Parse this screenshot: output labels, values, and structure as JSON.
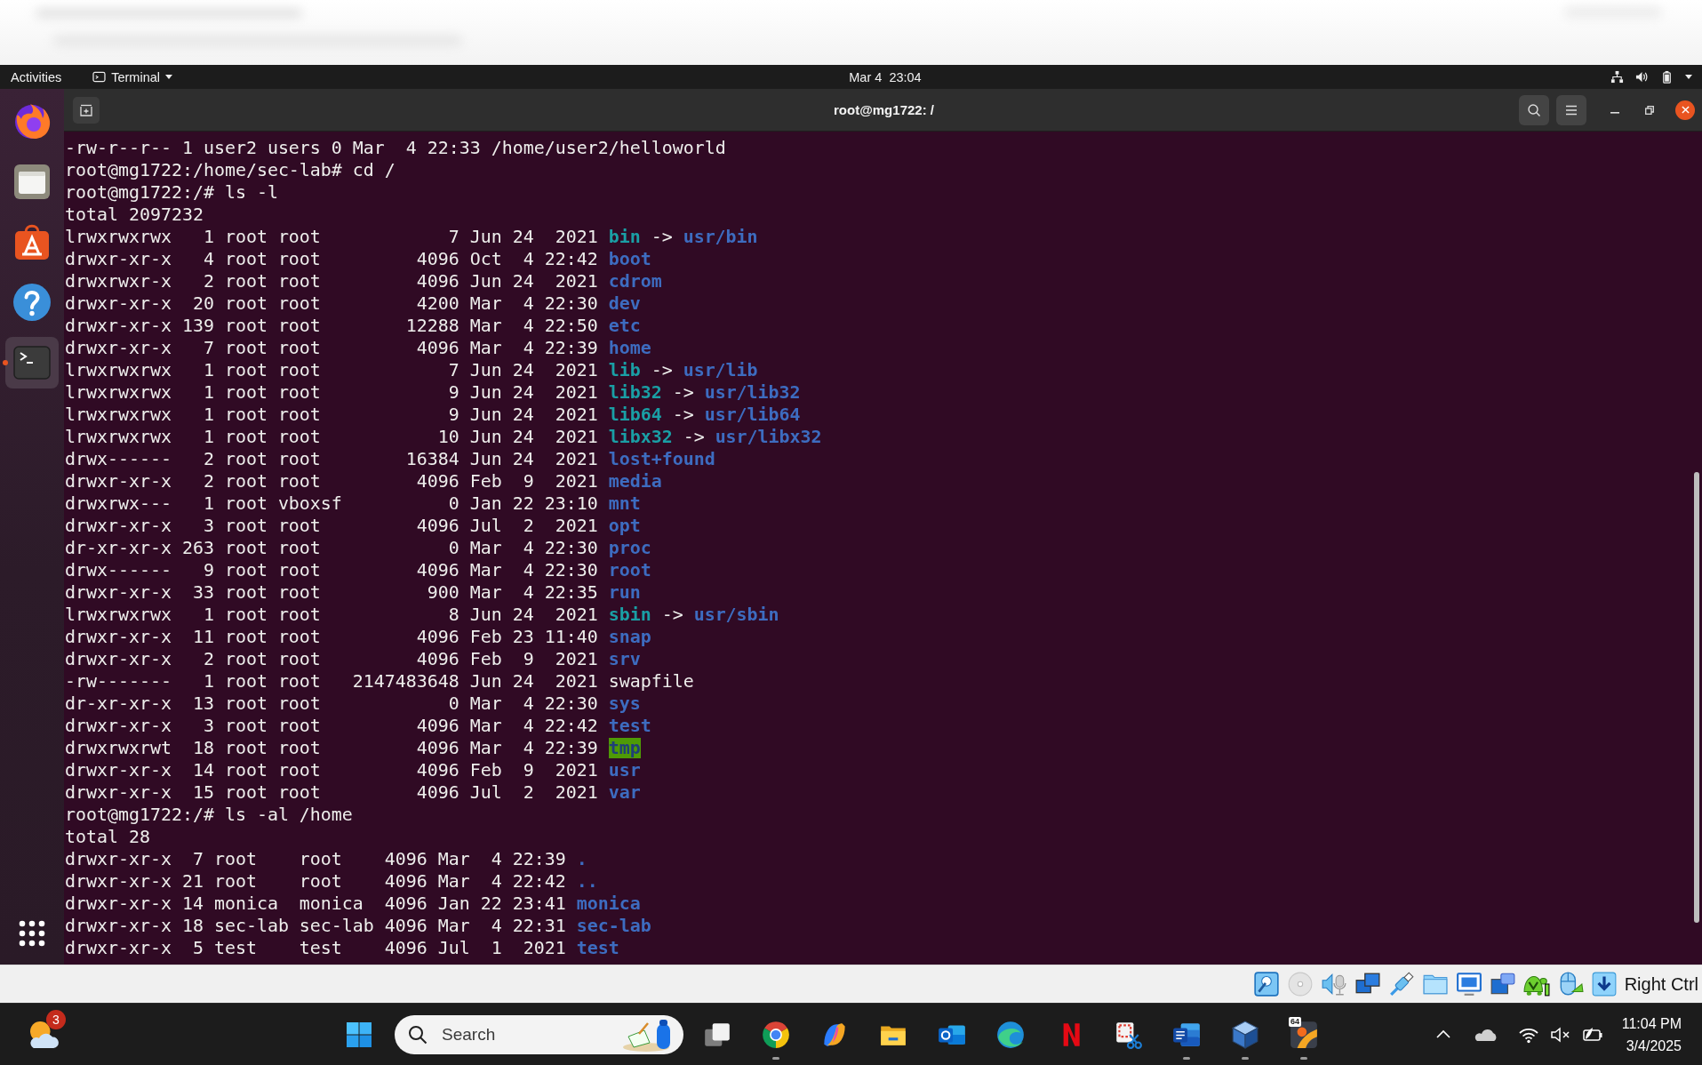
{
  "top_bar": {
    "activities": "Activities",
    "app_menu": "Terminal",
    "clock": "Mar 4  23:04"
  },
  "dock": {
    "items": [
      {
        "kind": "browser",
        "selected": false,
        "running": false
      },
      {
        "kind": "files",
        "selected": false,
        "running": false
      },
      {
        "kind": "store",
        "selected": false,
        "running": false
      },
      {
        "kind": "help",
        "selected": false,
        "running": false
      },
      {
        "kind": "terminal",
        "selected": true,
        "running": true
      }
    ]
  },
  "terminal": {
    "title": "root@mg1722: /",
    "lines": [
      {
        "kind": "text",
        "text": "-rw-r--r-- 1 user2 users 0 Mar  4 22:33 /home/user2/helloworld"
      },
      {
        "kind": "text",
        "text": "root@mg1722:/home/sec-lab# cd /"
      },
      {
        "kind": "text",
        "text": "root@mg1722:/# ls -l"
      },
      {
        "kind": "text",
        "text": "total 2097232"
      },
      {
        "kind": "entry",
        "details": "lrwxrwxrwx   1 root root            7 Jun 24  2021",
        "file": {
          "kind": "link",
          "name": "bin"
        },
        "arrow": "->",
        "target": "usr/bin"
      },
      {
        "kind": "entry",
        "details": "drwxr-xr-x   4 root root         4096 Oct  4 22:42",
        "file": {
          "kind": "dir",
          "name": "boot"
        }
      },
      {
        "kind": "entry",
        "details": "drwxrwxr-x   2 root root         4096 Jun 24  2021",
        "file": {
          "kind": "dir",
          "name": "cdrom"
        }
      },
      {
        "kind": "entry",
        "details": "drwxr-xr-x  20 root root         4200 Mar  4 22:30",
        "file": {
          "kind": "dir",
          "name": "dev"
        }
      },
      {
        "kind": "entry",
        "details": "drwxr-xr-x 139 root root        12288 Mar  4 22:50",
        "file": {
          "kind": "dir",
          "name": "etc"
        }
      },
      {
        "kind": "entry",
        "details": "drwxr-xr-x   7 root root         4096 Mar  4 22:39",
        "file": {
          "kind": "dir",
          "name": "home"
        }
      },
      {
        "kind": "entry",
        "details": "lrwxrwxrwx   1 root root            7 Jun 24  2021",
        "file": {
          "kind": "link",
          "name": "lib"
        },
        "arrow": "->",
        "target": "usr/lib"
      },
      {
        "kind": "entry",
        "details": "lrwxrwxrwx   1 root root            9 Jun 24  2021",
        "file": {
          "kind": "link",
          "name": "lib32"
        },
        "arrow": "->",
        "target": "usr/lib32"
      },
      {
        "kind": "entry",
        "details": "lrwxrwxrwx   1 root root            9 Jun 24  2021",
        "file": {
          "kind": "link",
          "name": "lib64"
        },
        "arrow": "->",
        "target": "usr/lib64"
      },
      {
        "kind": "entry",
        "details": "lrwxrwxrwx   1 root root           10 Jun 24  2021",
        "file": {
          "kind": "link",
          "name": "libx32"
        },
        "arrow": "->",
        "target": "usr/libx32"
      },
      {
        "kind": "entry",
        "details": "drwx------   2 root root        16384 Jun 24  2021",
        "file": {
          "kind": "dir",
          "name": "lost+found"
        }
      },
      {
        "kind": "entry",
        "details": "drwxr-xr-x   2 root root         4096 Feb  9  2021",
        "file": {
          "kind": "dir",
          "name": "media"
        }
      },
      {
        "kind": "entry",
        "details": "drwxrwx---   1 root vboxsf          0 Jan 22 23:10",
        "file": {
          "kind": "dir",
          "name": "mnt"
        }
      },
      {
        "kind": "entry",
        "details": "drwxr-xr-x   3 root root         4096 Jul  2  2021",
        "file": {
          "kind": "dir",
          "name": "opt"
        }
      },
      {
        "kind": "entry",
        "details": "dr-xr-xr-x 263 root root            0 Mar  4 22:30",
        "file": {
          "kind": "dir",
          "name": "proc"
        }
      },
      {
        "kind": "entry",
        "details": "drwx------   9 root root         4096 Mar  4 22:30",
        "file": {
          "kind": "dir",
          "name": "root"
        }
      },
      {
        "kind": "entry",
        "details": "drwxr-xr-x  33 root root          900 Mar  4 22:35",
        "file": {
          "kind": "dir",
          "name": "run"
        }
      },
      {
        "kind": "entry",
        "details": "lrwxrwxrwx   1 root root            8 Jun 24  2021",
        "file": {
          "kind": "link",
          "name": "sbin"
        },
        "arrow": "->",
        "target": "usr/sbin"
      },
      {
        "kind": "entry",
        "details": "drwxr-xr-x  11 root root         4096 Feb 23 11:40",
        "file": {
          "kind": "dir",
          "name": "snap"
        }
      },
      {
        "kind": "entry",
        "details": "drwxr-xr-x   2 root root         4096 Feb  9  2021",
        "file": {
          "kind": "dir",
          "name": "srv"
        }
      },
      {
        "kind": "entry",
        "details": "-rw-------   1 root root   2147483648 Jun 24  2021",
        "file": {
          "kind": "file",
          "name": "swapfile"
        }
      },
      {
        "kind": "entry",
        "details": "dr-xr-xr-x  13 root root            0 Mar  4 22:30",
        "file": {
          "kind": "dir",
          "name": "sys"
        }
      },
      {
        "kind": "entry",
        "details": "drwxr-xr-x   3 root root         4096 Mar  4 22:42",
        "file": {
          "kind": "dir",
          "name": "test"
        }
      },
      {
        "kind": "entry",
        "details": "drwxrwxrwt  18 root root         4096 Mar  4 22:39",
        "file": {
          "kind": "sticky",
          "name": "tmp"
        }
      },
      {
        "kind": "entry",
        "details": "drwxr-xr-x  14 root root         4096 Feb  9  2021",
        "file": {
          "kind": "dir",
          "name": "usr"
        }
      },
      {
        "kind": "entry",
        "details": "drwxr-xr-x  15 root root         4096 Jul  2  2021",
        "file": {
          "kind": "dir",
          "name": "var"
        }
      },
      {
        "kind": "text",
        "text": "root@mg1722:/# ls -al /home"
      },
      {
        "kind": "text",
        "text": "total 28"
      },
      {
        "kind": "entry",
        "details": "drwxr-xr-x  7 root    root    4096 Mar  4 22:39",
        "file": {
          "kind": "dir",
          "name": "."
        }
      },
      {
        "kind": "entry",
        "details": "drwxr-xr-x 21 root    root    4096 Mar  4 22:42",
        "file": {
          "kind": "dir",
          "name": ".."
        }
      },
      {
        "kind": "entry",
        "details": "drwxr-xr-x 14 monica  monica  4096 Jan 22 23:41",
        "file": {
          "kind": "dir",
          "name": "monica"
        }
      },
      {
        "kind": "entry",
        "details": "drwxr-xr-x 18 sec-lab sec-lab 4096 Mar  4 22:31",
        "file": {
          "kind": "dir",
          "name": "sec-lab"
        }
      },
      {
        "kind": "entry",
        "details": "drwxr-xr-x  5 test    test    4096 Jul  1  2021",
        "file": {
          "kind": "dir",
          "name": "test"
        }
      }
    ]
  },
  "vm_status_bar": {
    "host_key": "Right Ctrl"
  },
  "taskbar": {
    "weather_badge": "3",
    "search": {
      "placeholder": "Search"
    },
    "apps": [
      {
        "kind": "task_view",
        "running": false
      },
      {
        "kind": "ring",
        "running": true
      },
      {
        "kind": "ribbon",
        "running": false
      },
      {
        "kind": "folder",
        "running": false
      },
      {
        "kind": "mail",
        "running": false
      },
      {
        "kind": "swirl",
        "running": false
      },
      {
        "kind": "n_logo",
        "running": false
      },
      {
        "kind": "snip",
        "running": false
      },
      {
        "kind": "document",
        "running": true
      },
      {
        "kind": "cube",
        "running": true
      },
      {
        "kind": "tile",
        "running": true,
        "badge": "64"
      }
    ],
    "clock": {
      "time": "11:04 PM",
      "date": "3/4/2025"
    }
  }
}
